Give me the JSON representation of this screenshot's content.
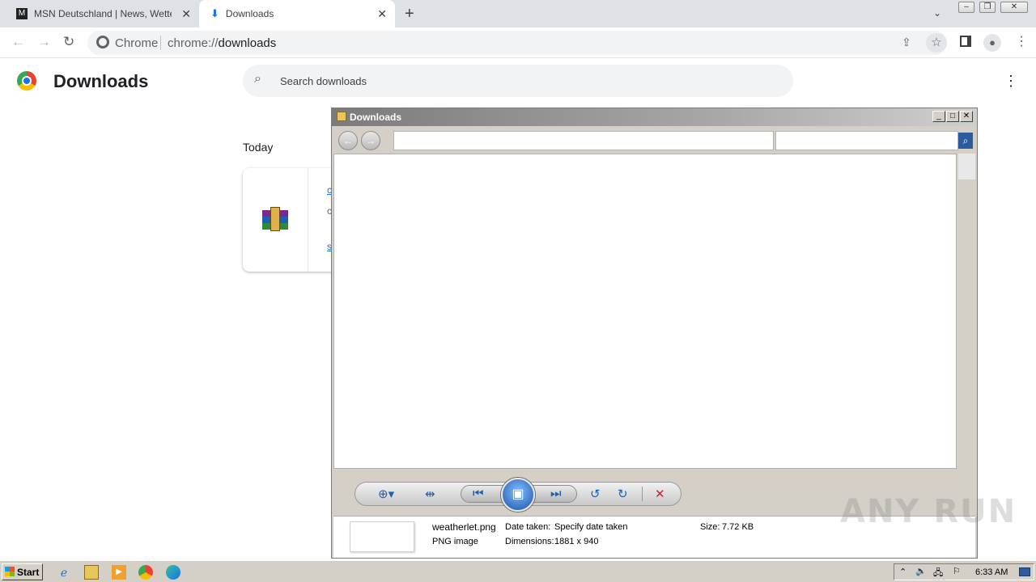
{
  "browser": {
    "tabs": [
      {
        "title": "MSN Deutschland | News, Wetter, Sport",
        "active": false
      },
      {
        "title": "Downloads",
        "active": true
      }
    ],
    "omnibox": {
      "site_label": "Chrome",
      "url_scheme": "chrome://",
      "url_host": "downloads"
    }
  },
  "downloads_page": {
    "title": "Downloads",
    "search_placeholder": "Search downloads",
    "day_label": "Today"
  },
  "photo_viewer": {
    "title": "Downloads",
    "file": {
      "name": "weatherlet.png",
      "type": "PNG image",
      "date_taken_label": "Date taken:",
      "date_taken_value": "Specify date taken",
      "dimensions_label": "Dimensions:",
      "dimensions_value": "1881 x 940",
      "size_label": "Size:",
      "size_value": "7.72 KB"
    }
  },
  "taskbar": {
    "start_label": "Start",
    "clock": "6:33 AM"
  },
  "watermark": "ANY RUN",
  "colors": {
    "chrome_tabstrip": "#dee1e6",
    "accent_blue": "#1a73e8",
    "taskbar": "#d4d0c8"
  }
}
